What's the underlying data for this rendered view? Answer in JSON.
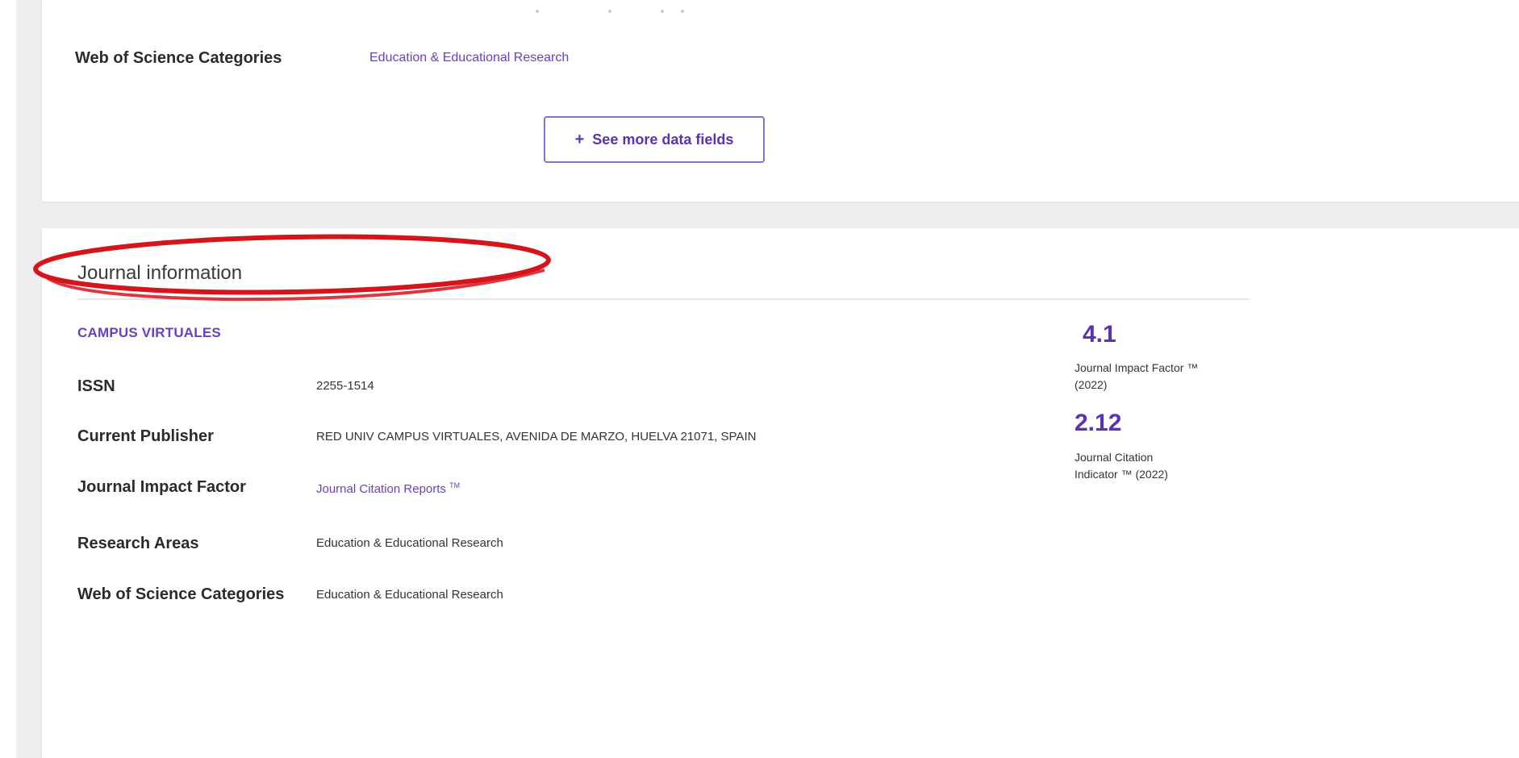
{
  "colors": {
    "link": "#6a3fc0",
    "metric": "#5b32b4",
    "annotation": "#d6141c",
    "button_border": "#8a6fd1"
  },
  "top_card": {
    "wos_categories_label": "Web of Science Categories",
    "wos_categories_value": "Education & Educational Research",
    "see_more_icon": "+",
    "see_more_label": "See more data fields"
  },
  "journal_info": {
    "heading": "Journal information",
    "journal_name": "CAMPUS VIRTUALES",
    "issn_label": "ISSN",
    "issn_value": "2255-1514",
    "publisher_label": "Current Publisher",
    "publisher_value": "RED UNIV CAMPUS VIRTUALES, AVENIDA DE MARZO, HUELVA 21071, SPAIN",
    "jif_label": "Journal Impact Factor",
    "jif_link": "Journal Citation Reports",
    "jif_link_tm": "TM",
    "research_areas_label": "Research Areas",
    "research_areas_value": "Education & Educational Research",
    "wos_categories_label": "Web of Science Categories",
    "wos_categories_value": "Education & Educational Research"
  },
  "metrics": {
    "jif_value": "4.1",
    "jif_label_line1": "Journal Impact Factor ™",
    "jif_label_line2": "(2022)",
    "jci_value": "2.12",
    "jci_label_line1": "Journal Citation",
    "jci_label_line2": "Indicator ™ (2022)"
  }
}
